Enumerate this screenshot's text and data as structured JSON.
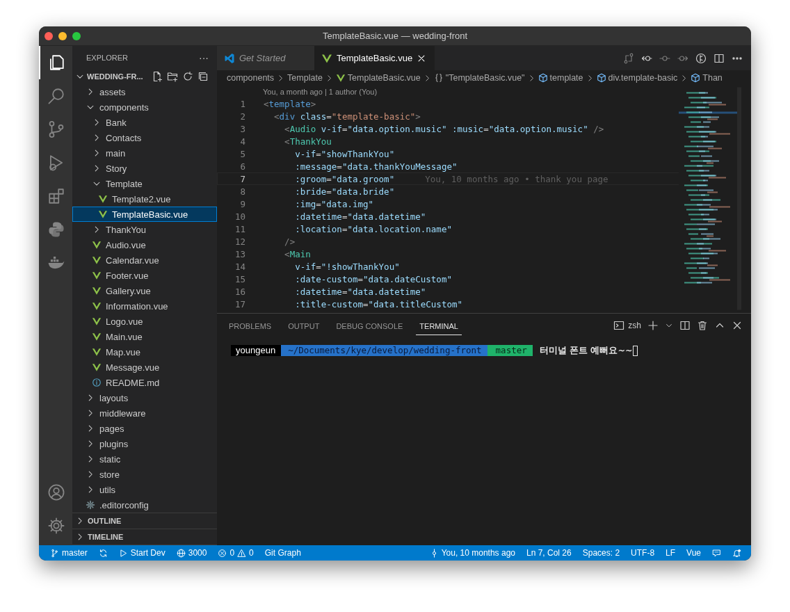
{
  "window": {
    "title": "TemplateBasic.vue — wedding-front"
  },
  "activity_bar": {
    "top": [
      {
        "selected": true
      },
      {
        "selected": false
      },
      {
        "selected": false
      },
      {
        "selected": false
      },
      {
        "selected": false
      },
      {
        "selected": false
      },
      {
        "selected": false
      }
    ],
    "bottom": [
      {
        "selected": false
      },
      {
        "selected": false
      }
    ]
  },
  "sidebar": {
    "title": "EXPLORER",
    "more": "···",
    "workspace": {
      "name": "WEDDING-FR...",
      "expanded": true
    },
    "items": [
      {
        "label": "assets",
        "kind": "folder",
        "expanded": false,
        "selected": false
      },
      {
        "label": "components",
        "kind": "folder",
        "expanded": true,
        "selected": false,
        "children": [
          {
            "label": "Bank",
            "kind": "folder",
            "expanded": false,
            "selected": false
          },
          {
            "label": "Contacts",
            "kind": "folder",
            "expanded": false,
            "selected": false
          },
          {
            "label": "main",
            "kind": "folder",
            "expanded": false,
            "selected": false
          },
          {
            "label": "Story",
            "kind": "folder",
            "expanded": false,
            "selected": false
          },
          {
            "label": "Template",
            "kind": "folder",
            "expanded": true,
            "selected": false,
            "children": [
              {
                "label": "Template2.vue",
                "kind": "vue",
                "selected": false
              },
              {
                "label": "TemplateBasic.vue",
                "kind": "vue",
                "selected": true
              }
            ]
          },
          {
            "label": "ThankYou",
            "kind": "folder",
            "expanded": false,
            "selected": false
          },
          {
            "label": "Audio.vue",
            "kind": "vue",
            "selected": false
          },
          {
            "label": "Calendar.vue",
            "kind": "vue",
            "selected": false
          },
          {
            "label": "Footer.vue",
            "kind": "vue",
            "selected": false
          },
          {
            "label": "Gallery.vue",
            "kind": "vue",
            "selected": false
          },
          {
            "label": "Information.vue",
            "kind": "vue",
            "selected": false
          },
          {
            "label": "Logo.vue",
            "kind": "vue",
            "selected": false
          },
          {
            "label": "Main.vue",
            "kind": "vue",
            "selected": false
          },
          {
            "label": "Map.vue",
            "kind": "vue",
            "selected": false
          },
          {
            "label": "Message.vue",
            "kind": "vue",
            "selected": false
          },
          {
            "label": "README.md",
            "kind": "info",
            "selected": false
          }
        ]
      },
      {
        "label": "layouts",
        "kind": "folder",
        "expanded": false,
        "selected": false
      },
      {
        "label": "middleware",
        "kind": "folder",
        "expanded": false,
        "selected": false
      },
      {
        "label": "pages",
        "kind": "folder",
        "expanded": false,
        "selected": false
      },
      {
        "label": "plugins",
        "kind": "folder",
        "expanded": false,
        "selected": false
      },
      {
        "label": "static",
        "kind": "folder",
        "expanded": false,
        "selected": false
      },
      {
        "label": "store",
        "kind": "folder",
        "expanded": false,
        "selected": false
      },
      {
        "label": "utils",
        "kind": "folder",
        "expanded": false,
        "selected": false
      },
      {
        "label": ".editorconfig",
        "kind": "config",
        "selected": false
      }
    ],
    "sections": [
      {
        "label": "OUTLINE",
        "expanded": false
      },
      {
        "label": "TIMELINE",
        "expanded": false
      }
    ]
  },
  "editor_tabs": [
    {
      "label": "Get Started",
      "kind": "welcome",
      "selected": false,
      "preview": true
    },
    {
      "label": "TemplateBasic.vue",
      "kind": "vue",
      "selected": true,
      "preview": false
    }
  ],
  "breadcrumbs": [
    {
      "label": "components",
      "kind": "folder"
    },
    {
      "label": "Template",
      "kind": "folder"
    },
    {
      "label": "TemplateBasic.vue",
      "kind": "vue"
    },
    {
      "label": "\"TemplateBasic.vue\"",
      "kind": "module"
    },
    {
      "label": "template",
      "kind": "element"
    },
    {
      "label": "div.template-basic",
      "kind": "element"
    },
    {
      "label": "Than",
      "kind": "element"
    }
  ],
  "codelens": "You, a month ago | 1 author (You)",
  "code": [
    {
      "number": "1",
      "current": false,
      "tokens": [
        {
          "kind": "punct",
          "text": "<"
        },
        {
          "kind": "tag",
          "text": "template"
        },
        {
          "kind": "punct",
          "text": ">"
        }
      ]
    },
    {
      "number": "2",
      "current": false,
      "tokens": [
        {
          "kind": "punct",
          "text": "  <"
        },
        {
          "kind": "tag",
          "text": "div"
        },
        {
          "kind": "attr",
          "text": " class"
        },
        {
          "kind": "plain",
          "text": "="
        },
        {
          "kind": "string",
          "text": "\"template-basic\""
        },
        {
          "kind": "punct",
          "text": ">"
        }
      ]
    },
    {
      "number": "3",
      "current": false,
      "tokens": [
        {
          "kind": "punct",
          "text": "    <"
        },
        {
          "kind": "component",
          "text": "Audio"
        },
        {
          "kind": "attr",
          "text": " v-if"
        },
        {
          "kind": "plain",
          "text": "="
        },
        {
          "kind": "expr",
          "text": "\"data.option.music\""
        },
        {
          "kind": "attr",
          "text": " :music"
        },
        {
          "kind": "plain",
          "text": "="
        },
        {
          "kind": "expr",
          "text": "\"data.option.music\""
        },
        {
          "kind": "punct",
          "text": " />"
        }
      ]
    },
    {
      "number": "4",
      "current": false,
      "tokens": [
        {
          "kind": "punct",
          "text": "    <"
        },
        {
          "kind": "component",
          "text": "ThankYou"
        }
      ]
    },
    {
      "number": "5",
      "current": false,
      "tokens": [
        {
          "kind": "attr",
          "text": "      v-if"
        },
        {
          "kind": "plain",
          "text": "="
        },
        {
          "kind": "expr",
          "text": "\"showThankYou\""
        }
      ]
    },
    {
      "number": "6",
      "current": false,
      "tokens": [
        {
          "kind": "attr",
          "text": "      :message"
        },
        {
          "kind": "plain",
          "text": "="
        },
        {
          "kind": "expr",
          "text": "\"data.thankYouMessage\""
        }
      ]
    },
    {
      "number": "7",
      "current": true,
      "blame": "You, 10 months ago • thank you page",
      "tokens": [
        {
          "kind": "attr",
          "text": "      :groom"
        },
        {
          "kind": "plain",
          "text": "="
        },
        {
          "kind": "expr",
          "text": "\"data.groom\""
        }
      ]
    },
    {
      "number": "8",
      "current": false,
      "tokens": [
        {
          "kind": "attr",
          "text": "      :bride"
        },
        {
          "kind": "plain",
          "text": "="
        },
        {
          "kind": "expr",
          "text": "\"data.bride\""
        }
      ]
    },
    {
      "number": "9",
      "current": false,
      "tokens": [
        {
          "kind": "attr",
          "text": "      :img"
        },
        {
          "kind": "plain",
          "text": "="
        },
        {
          "kind": "expr",
          "text": "\"data.img\""
        }
      ]
    },
    {
      "number": "10",
      "current": false,
      "tokens": [
        {
          "kind": "attr",
          "text": "      :datetime"
        },
        {
          "kind": "plain",
          "text": "="
        },
        {
          "kind": "expr",
          "text": "\"data.datetime\""
        }
      ]
    },
    {
      "number": "11",
      "current": false,
      "tokens": [
        {
          "kind": "attr",
          "text": "      :location"
        },
        {
          "kind": "plain",
          "text": "="
        },
        {
          "kind": "expr",
          "text": "\"data.location.name\""
        }
      ]
    },
    {
      "number": "12",
      "current": false,
      "tokens": [
        {
          "kind": "punct",
          "text": "    />"
        }
      ]
    },
    {
      "number": "13",
      "current": false,
      "tokens": [
        {
          "kind": "punct",
          "text": "    <"
        },
        {
          "kind": "component",
          "text": "Main"
        }
      ]
    },
    {
      "number": "14",
      "current": false,
      "tokens": [
        {
          "kind": "attr",
          "text": "      v-if"
        },
        {
          "kind": "plain",
          "text": "="
        },
        {
          "kind": "expr",
          "text": "\"!showThankYou\""
        }
      ]
    },
    {
      "number": "15",
      "current": false,
      "tokens": [
        {
          "kind": "attr",
          "text": "      :date-custom"
        },
        {
          "kind": "plain",
          "text": "="
        },
        {
          "kind": "expr",
          "text": "\"data.dateCustom\""
        }
      ]
    },
    {
      "number": "16",
      "current": false,
      "tokens": [
        {
          "kind": "attr",
          "text": "      :datetime"
        },
        {
          "kind": "plain",
          "text": "="
        },
        {
          "kind": "expr",
          "text": "\"data.datetime\""
        }
      ]
    },
    {
      "number": "17",
      "current": false,
      "tokens": [
        {
          "kind": "attr",
          "text": "      :title-custom"
        },
        {
          "kind": "plain",
          "text": "="
        },
        {
          "kind": "expr",
          "text": "\"data.titleCustom\""
        }
      ]
    }
  ],
  "panel": {
    "tabs": [
      {
        "label": "PROBLEMS",
        "selected": false
      },
      {
        "label": "OUTPUT",
        "selected": false
      },
      {
        "label": "DEBUG CONSOLE",
        "selected": false
      },
      {
        "label": "TERMINAL",
        "selected": true
      }
    ],
    "shell": "zsh",
    "prompt": {
      "user": "youngeun",
      "path": "~/Documents/kye/develop/wedding-front",
      "branch": "master",
      "input": "터미널 폰트 예뻐요~~"
    }
  },
  "status_bar": {
    "left": [
      {
        "kind": "branch",
        "text": "master"
      },
      {
        "kind": "sync"
      },
      {
        "kind": "task",
        "text": "Start Dev"
      },
      {
        "kind": "port",
        "text": "3000"
      },
      {
        "kind": "problems",
        "errors": "0",
        "warnings": "0"
      },
      {
        "kind": "text",
        "text": "Git Graph"
      }
    ],
    "right": [
      {
        "kind": "blame",
        "text": "You, 10 months ago"
      },
      {
        "kind": "text",
        "text": "Ln 7, Col 26"
      },
      {
        "kind": "text",
        "text": "Spaces: 2"
      },
      {
        "kind": "text",
        "text": "UTF-8"
      },
      {
        "kind": "text",
        "text": "LF"
      },
      {
        "kind": "text",
        "text": "Vue"
      },
      {
        "kind": "feedback"
      },
      {
        "kind": "notifications"
      }
    ]
  }
}
